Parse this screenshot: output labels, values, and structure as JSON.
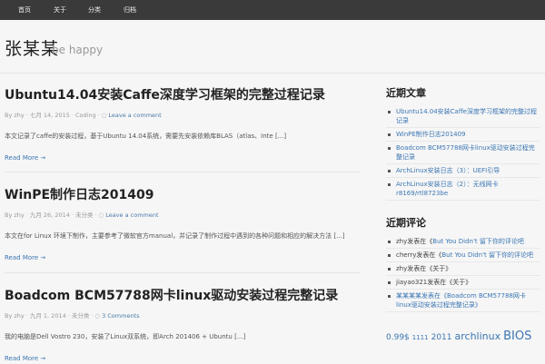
{
  "nav": {
    "items": [
      "首页",
      "关于",
      "分类",
      "归档"
    ]
  },
  "header": {
    "site_title": "张某某",
    "description": "be happy"
  },
  "posts": [
    {
      "title": "Ubuntu14.04安装Caffe深度学习框架的完整过程记录",
      "author": "By zhy",
      "date": "七月 14, 2015",
      "category": "Coding",
      "comments": "Leave a comment",
      "excerpt": "本文记录了caffe的安装过程，基于Ubuntu 14.04系统，需要先安装依赖库BLAS（atlas、Inte [...]",
      "read_more": "Read More →"
    },
    {
      "title": "WinPE制作日志201409",
      "author": "By zhy",
      "date": "九月 26, 2014",
      "category": "未分类",
      "comments": "Leave a comment",
      "excerpt": "本文在for Linux 环境下制作，主要参考了微软官方manual，并记录了制作过程中遇到的各种问题和相应的解决方法 [...]",
      "read_more": "Read More →"
    },
    {
      "title": "Boadcom BCM57788网卡linux驱动安装过程完整记录",
      "author": "By zhy",
      "date": "九月 1, 2014",
      "category": "未分类",
      "comments": "3 Comments",
      "excerpt": "我的电脑是Dell Vostro 230，安装了Linux双系统，即Arch 201406 + Ubuntu [...]",
      "read_more": "Read More →"
    }
  ],
  "sidebar": {
    "recent_posts": {
      "title": "近期文章",
      "items": [
        "Ubuntu14.04安装Caffe深度学习框架的完整过程记录",
        "WinPE制作日志201409",
        "Boadcom BCM57788网卡linux驱动安装过程完整记录",
        "ArchLinux安装日志（3）：UEFI引导",
        "ArchLinux安装日志（2）：无线网卡r8169/rtl8723be"
      ]
    },
    "recent_comments": {
      "title": "近期评论",
      "items": [
        {
          "author": "zhy",
          "text": "发表在《",
          "post": "But You Didn't 留下你的评论吧"
        },
        {
          "author": "cherry",
          "text": "发表在《",
          "post": "But You Didn't 留下你的评论吧"
        },
        {
          "author": "zhy",
          "text": "发表在《关于》",
          "post": ""
        },
        {
          "author": "jiayao321",
          "text": "发表在《关于》",
          "post": ""
        },
        {
          "author": "",
          "text": "",
          "post": "某某某某发表在《Boadcom BCM57788网卡linux驱动安装过程完整记录》"
        }
      ]
    },
    "tags": {
      "items": [
        {
          "label": "0.99$",
          "size": 9
        },
        {
          "label": "1111",
          "size": 7
        },
        {
          "label": "2011",
          "size": 9
        },
        {
          "label": "archlinux",
          "size": 11
        },
        {
          "label": "BIOS",
          "size": 13
        }
      ]
    }
  }
}
